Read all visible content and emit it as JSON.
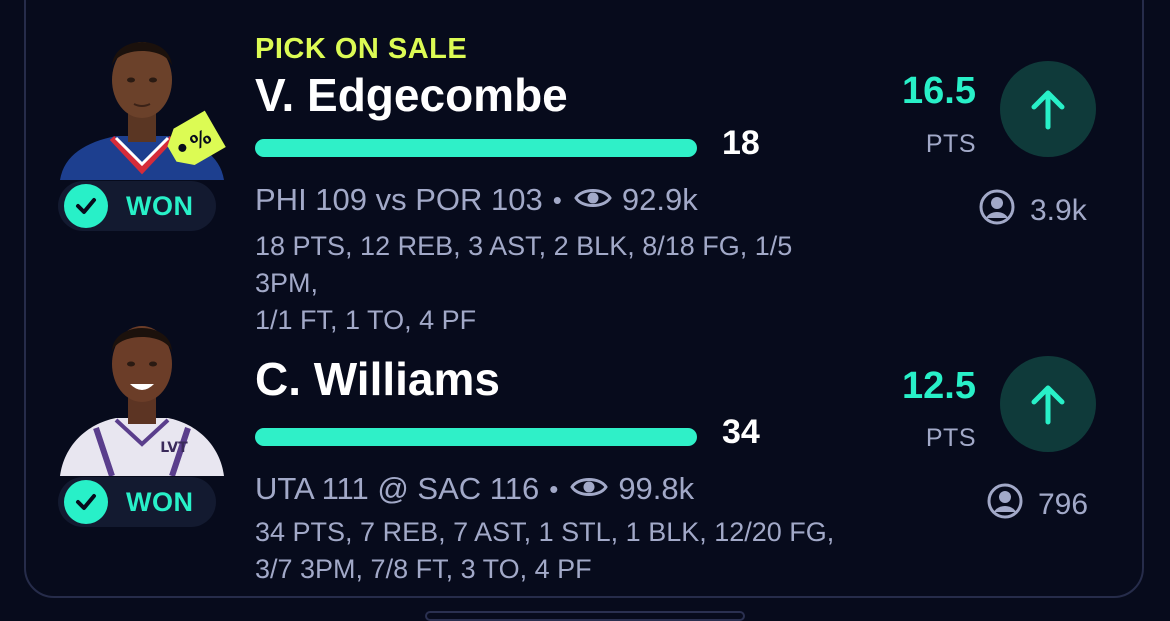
{
  "picks": [
    {
      "sale_label": "PICK ON SALE",
      "player": "V. Edgecombe",
      "actual": "18",
      "status": "WON",
      "game": "PHI 109 vs POR 103",
      "dot": "•",
      "viewers": "92.9k",
      "stats_line1": "18 PTS, 12 REB, 3 AST, 2 BLK, 8/18 FG, 1/5 3PM,",
      "stats_line2": "1/1 FT, 1 TO, 4 PF",
      "line_value": "16.5",
      "line_unit": "PTS",
      "direction": "up",
      "picks_count": "3.9k",
      "badge_icon": "percent-tag-icon"
    },
    {
      "sale_label": "",
      "player": "C. Williams",
      "actual": "34",
      "status": "WON",
      "game": "UTA 111 @ SAC 116",
      "dot": "•",
      "viewers": "99.8k",
      "stats_line1": "34 PTS, 7 REB, 7 AST, 1 STL, 1 BLK, 12/20 FG,",
      "stats_line2": "3/7 3PM, 7/8 FT, 3 TO, 4 PF",
      "line_value": "12.5",
      "line_unit": "PTS",
      "direction": "up",
      "picks_count": "796"
    }
  ],
  "colors": {
    "background": "#070b1c",
    "accent": "#28f0c8",
    "sale": "#dcfb54",
    "muted_text": "#a2a9c8"
  }
}
